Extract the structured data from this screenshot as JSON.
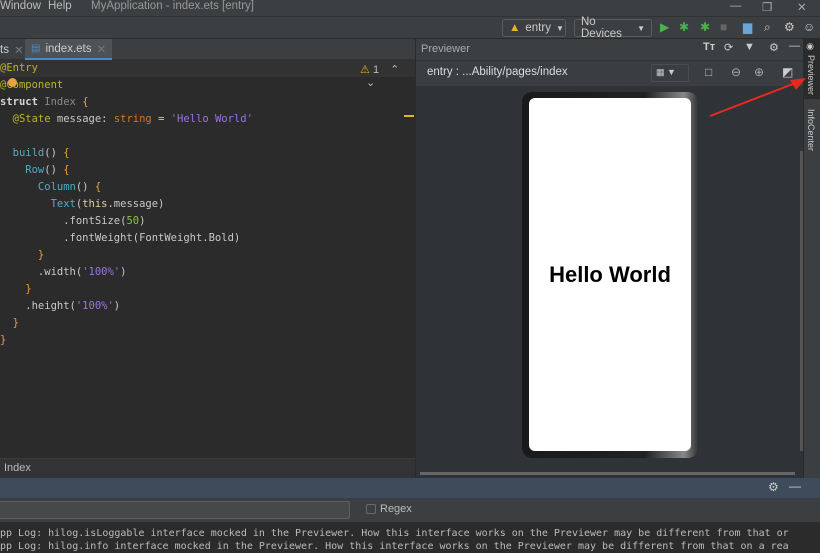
{
  "menu": {
    "items": [
      "Window",
      "Help"
    ],
    "title": "MyApplication - index.ets [entry]"
  },
  "window_controls": {
    "minimize": "—",
    "maximize": "❐",
    "close": "✕"
  },
  "toolbar": {
    "module": "entry",
    "device": "No Devices",
    "icons": [
      "run-icon",
      "debug-icon",
      "attach-debugger-icon",
      "stop-icon",
      "project-structure-icon",
      "search-icon",
      "settings-icon",
      "account-icon"
    ]
  },
  "editor_tabs": [
    {
      "label": "ts",
      "close": "✕"
    },
    {
      "label": "index.ets",
      "close": "✕",
      "active": true
    }
  ],
  "inspection": {
    "warnings": "1",
    "warning_icon": "⚠"
  },
  "code": [
    [
      {
        "t": "@Entry",
        "k": "ann"
      }
    ],
    [
      {
        "t": "@Component",
        "k": "ann"
      }
    ],
    [
      {
        "t": "struct ",
        "k": "kw"
      },
      {
        "t": "Index ",
        "k": "dim"
      },
      {
        "t": "{",
        "k": "br"
      }
    ],
    [
      {
        "t": "  @State ",
        "k": "ann"
      },
      {
        "t": "message: ",
        "k": "plain"
      },
      {
        "t": "string",
        "k": "type"
      },
      {
        "t": " = ",
        "k": "plain"
      },
      {
        "t": "'Hello World'",
        "k": "str"
      }
    ],
    [],
    [
      {
        "t": "  build",
        "k": "fn"
      },
      {
        "t": "() ",
        "k": "plain"
      },
      {
        "t": "{",
        "k": "br"
      }
    ],
    [
      {
        "t": "    Row",
        "k": "fn"
      },
      {
        "t": "() ",
        "k": "plain"
      },
      {
        "t": "{",
        "k": "br"
      }
    ],
    [
      {
        "t": "      Column",
        "k": "fn"
      },
      {
        "t": "() ",
        "k": "plain"
      },
      {
        "t": "{",
        "k": "br"
      }
    ],
    [
      {
        "t": "        Text",
        "k": "fn"
      },
      {
        "t": "(",
        "k": "plain"
      },
      {
        "t": "this",
        "k": "this"
      },
      {
        "t": ".message)",
        "k": "plain"
      }
    ],
    [
      {
        "t": "          .fontSize(",
        "k": "plain"
      },
      {
        "t": "50",
        "k": "num"
      },
      {
        "t": ")",
        "k": "plain"
      }
    ],
    [
      {
        "t": "          .fontWeight(FontWeight.Bold)",
        "k": "plain"
      }
    ],
    [
      {
        "t": "      }",
        "k": "br"
      }
    ],
    [
      {
        "t": "      .width(",
        "k": "plain"
      },
      {
        "t": "'100%'",
        "k": "str"
      },
      {
        "t": ")",
        "k": "plain"
      }
    ],
    [
      {
        "t": "    }",
        "k": "br"
      }
    ],
    [
      {
        "t": "    .height(",
        "k": "plain"
      },
      {
        "t": "'100%'",
        "k": "str"
      },
      {
        "t": ")",
        "k": "plain"
      }
    ],
    [
      {
        "t": "  }",
        "k": "br"
      }
    ],
    [
      {
        "t": "}",
        "k": "br"
      }
    ]
  ],
  "breadcrumb": "Index",
  "previewer": {
    "title": "Previewer",
    "path": "entry : ...Ability/pages/index",
    "screen_text": "Hello World"
  },
  "side_tabs": [
    "Previewer",
    "InfoCenter"
  ],
  "log_panel": {
    "regex_label": "Regex",
    "filter_value": "",
    "lines": [
      "pp Log: hilog.isLoggable interface mocked in the Previewer. How this interface works on the Previewer may be different from that or",
      "pp Log: hilog.info interface mocked in the Previewer. How this interface works on the Previewer may be different from that on a rea"
    ]
  },
  "colors": {
    "accent_arrow": "#e8291f",
    "run": "#4caf50",
    "bottom_header": "#3d4b5b"
  }
}
